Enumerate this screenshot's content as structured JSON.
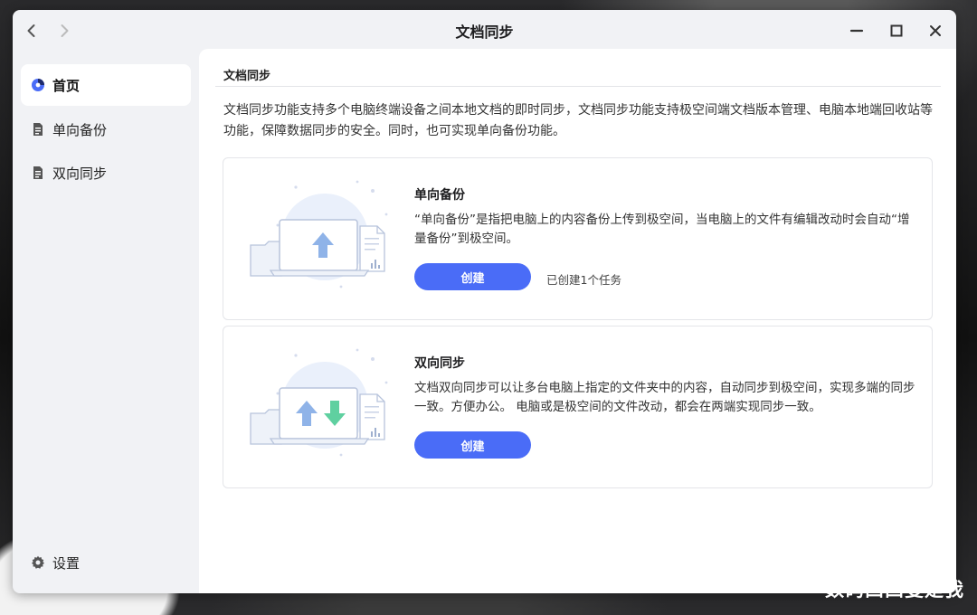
{
  "window": {
    "title": "文档同步"
  },
  "sidebar": {
    "items": [
      {
        "label": "首页",
        "icon": "home-icon",
        "active": true
      },
      {
        "label": "单向备份",
        "icon": "document-icon"
      },
      {
        "label": "双向同步",
        "icon": "document-icon"
      }
    ],
    "settings": {
      "label": "设置",
      "icon": "gear-icon"
    }
  },
  "main": {
    "section_title": "文档同步",
    "intro": "文档同步功能支持多个电脑终端设备之间本地文档的即时同步，文档同步功能支持极空间端文档版本管理、电脑本地端回收站等功能，保障数据同步的安全。同时，也可实现单向备份功能。",
    "cards": [
      {
        "title": "单向备份",
        "description": "“单向备份”是指把电脑上的内容备份上传到极空间，当电脑上的文件有编辑改动时会自动“增量备份”到极空间。",
        "button": "创建",
        "status": "已创建1个任务",
        "illustration": "upload-illustration"
      },
      {
        "title": "双向同步",
        "description": "文档双向同步可以让多台电脑上指定的文件夹中的内容，自动同步到极空间，实现多端的同步一致。方便办公。 电脑或是极空间的文件改动，都会在两端实现同步一致。",
        "button": "创建",
        "illustration": "sync-illustration"
      }
    ]
  },
  "colors": {
    "accent": "#4a6cf7",
    "arrow_up": "#8fb3e8",
    "arrow_down": "#5fd0a0"
  },
  "watermark": "数码凹凸曼是我"
}
